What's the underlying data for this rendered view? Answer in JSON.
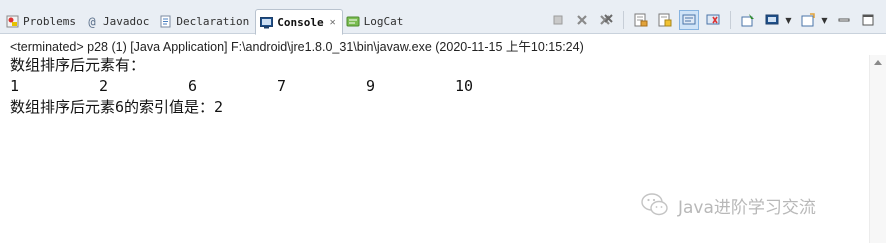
{
  "tabs": [
    {
      "label": "Problems",
      "icon": "problems-icon"
    },
    {
      "label": "Javadoc",
      "icon": "javadoc-icon"
    },
    {
      "label": "Declaration",
      "icon": "declaration-icon"
    },
    {
      "label": "Console",
      "icon": "console-icon",
      "active": true
    },
    {
      "label": "LogCat",
      "icon": "logcat-icon"
    }
  ],
  "console": {
    "header": "<terminated> p28 (1) [Java Application] F:\\android\\jre1.8.0_31\\bin\\javaw.exe (2020-11-15 上午10:15:24)",
    "line1": "数组排序后元素有：",
    "numbers": [
      "1",
      "2",
      "6",
      "7",
      "9",
      "10"
    ],
    "line3": "数组排序后元素6的索引值是：2"
  },
  "watermark": {
    "text": "Java进阶学习交流"
  },
  "colors": {
    "tabbar_bg": "#e9eef4",
    "console_text": "#111111",
    "pressed_button": "#cfe3f7",
    "watermark": "#b8b8b8"
  }
}
